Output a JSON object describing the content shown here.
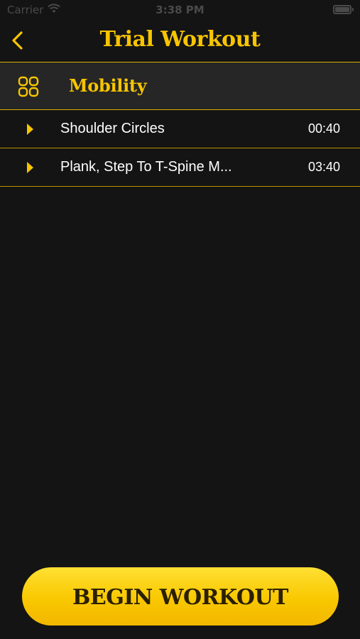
{
  "status_bar": {
    "carrier": "Carrier",
    "time": "3:38 PM",
    "wifi_icon": "wifi-icon",
    "battery_icon": "battery-icon"
  },
  "nav": {
    "title": "Trial Workout",
    "back_icon": "chevron-left-icon"
  },
  "section": {
    "title": "Mobility",
    "icon": "grid-icon"
  },
  "exercises": [
    {
      "name": "Shoulder Circles",
      "duration": "00:40",
      "icon": "play-triangle-icon"
    },
    {
      "name": "Plank, Step To T-Spine M...",
      "duration": "03:40",
      "icon": "play-triangle-icon"
    }
  ],
  "actions": {
    "begin_label": "BEGIN WORKOUT"
  },
  "colors": {
    "accent": "#f7c500",
    "background": "#141414",
    "header_background": "#262626",
    "divider": "#b89600"
  }
}
